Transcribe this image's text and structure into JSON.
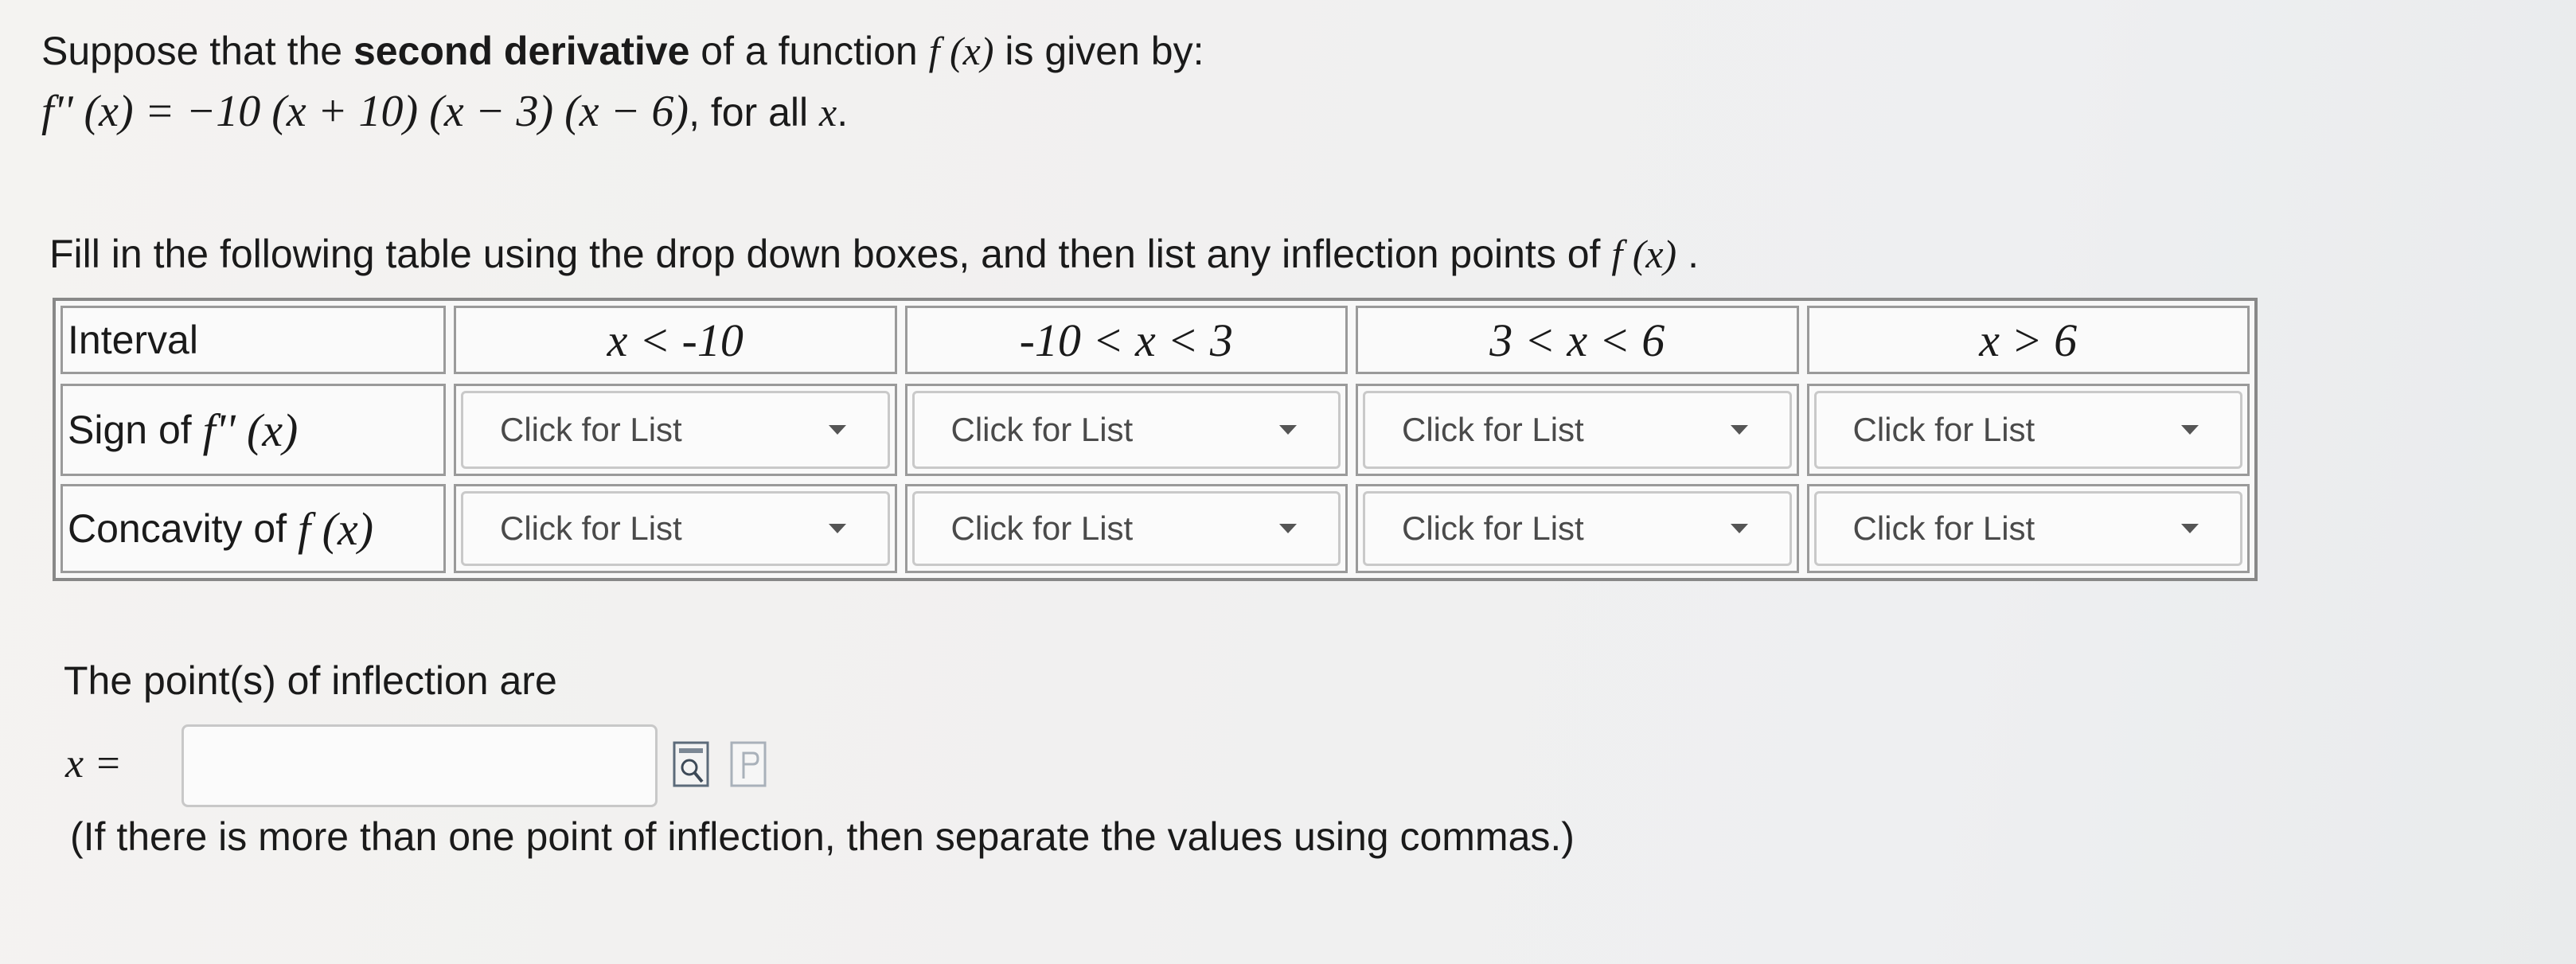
{
  "intro": {
    "prefix": "Suppose that the ",
    "bold": "second derivative",
    "suffix": " of a function ",
    "func": "f (x)",
    "tail": "  is given by:",
    "formula": "f'' (x) = −10 (x + 10) (x − 3) (x − 6)",
    "formula_tail": ", for all ",
    "var": "x",
    "period": "."
  },
  "instructions": {
    "text": "Fill in the following table using the drop down boxes, and then list any inflection points of ",
    "func": "f (x)",
    "period": " ."
  },
  "table": {
    "header_label": "Interval",
    "intervals": [
      "x < -10",
      "-10 < x < 3",
      "3 < x < 6",
      "x > 6"
    ],
    "rows": [
      {
        "label_prefix": "Sign of ",
        "label_math": "f'' (x)",
        "dropdowns": [
          "Click for List",
          "Click for List",
          "Click for List",
          "Click for List"
        ]
      },
      {
        "label_prefix": "Concavity of ",
        "label_math": "f (x)",
        "dropdowns": [
          "Click for List",
          "Click for List",
          "Click for List",
          "Click for List"
        ]
      }
    ]
  },
  "answer": {
    "label": "The point(s) of inflection are",
    "var_label": "x =",
    "value": "",
    "note": "(If there is more than one point of inflection, then separate the values using commas.)"
  },
  "icons": [
    "preview-icon",
    "formula-icon"
  ]
}
